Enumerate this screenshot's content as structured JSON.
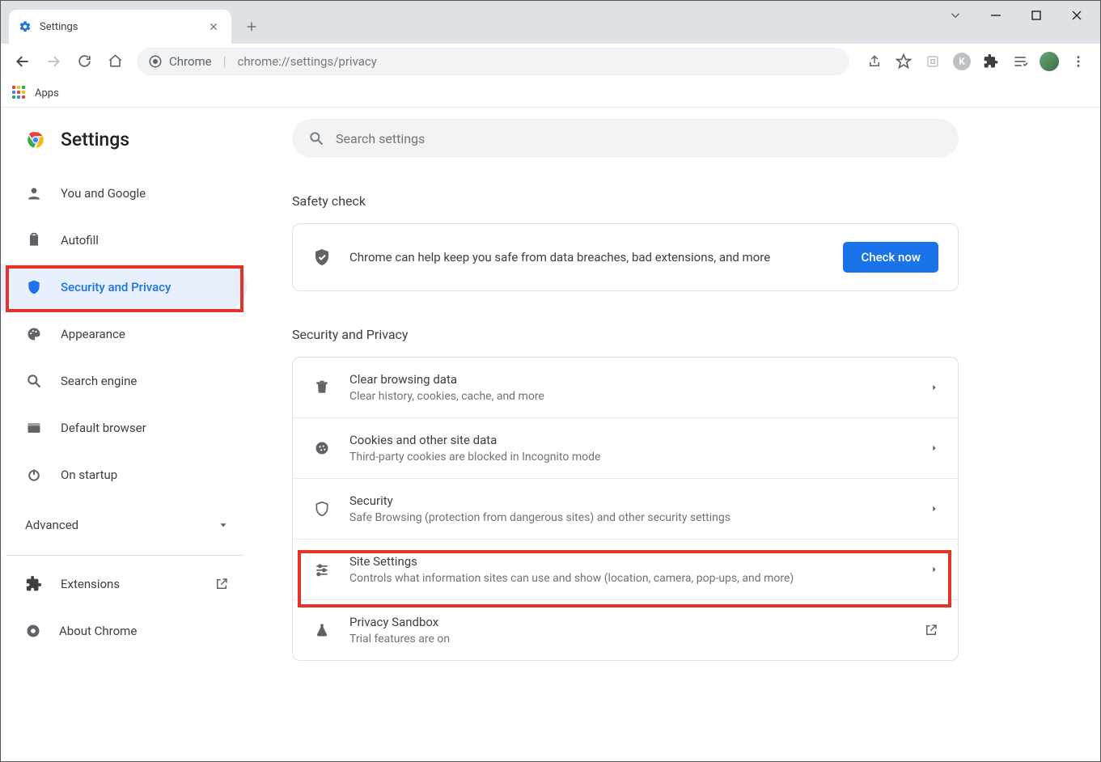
{
  "window": {
    "tab_title": "Settings",
    "new_tab": "+"
  },
  "url": {
    "origin": "Chrome",
    "path": "chrome://settings/privacy"
  },
  "bookmarks": {
    "apps": "Apps"
  },
  "brand": "Settings",
  "search": {
    "placeholder": "Search settings"
  },
  "nav": {
    "you": "You and Google",
    "autofill": "Autofill",
    "security": "Security and Privacy",
    "appearance": "Appearance",
    "search_engine": "Search engine",
    "default_browser": "Default browser",
    "on_startup": "On startup",
    "advanced": "Advanced",
    "extensions": "Extensions",
    "about": "About Chrome"
  },
  "sections": {
    "safety_check": "Safety check",
    "security_privacy": "Security and Privacy"
  },
  "safety": {
    "text": "Chrome can help keep you safe from data breaches, bad extensions, and more",
    "button": "Check now"
  },
  "rows": {
    "clear": {
      "title": "Clear browsing data",
      "sub": "Clear history, cookies, cache, and more"
    },
    "cookies": {
      "title": "Cookies and other site data",
      "sub": "Third-party cookies are blocked in Incognito mode"
    },
    "security": {
      "title": "Security",
      "sub": "Safe Browsing (protection from dangerous sites) and other security settings"
    },
    "site": {
      "title": "Site Settings",
      "sub": "Controls what information sites can use and show (location, camera, pop-ups, and more)"
    },
    "sandbox": {
      "title": "Privacy Sandbox",
      "sub": "Trial features are on"
    }
  }
}
